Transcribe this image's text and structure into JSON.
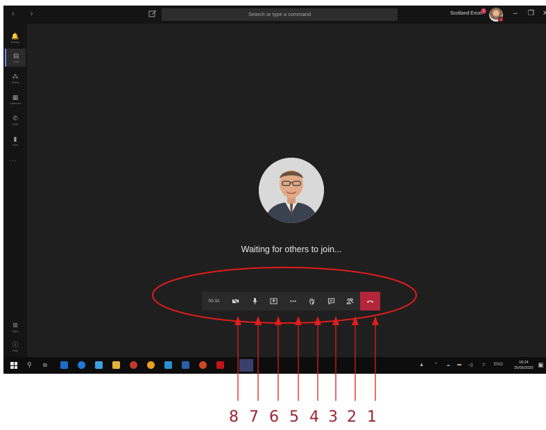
{
  "titlebar": {
    "nav": "‹ ›",
    "search_placeholder": "Search or type a command",
    "org_name": "Scotland Excel",
    "org_badge": "1",
    "minimize": "–",
    "maximize": "❐",
    "close": "✕"
  },
  "rail": {
    "items": [
      {
        "label": "Activity",
        "icon": "bell-icon",
        "glyph": "🔔"
      },
      {
        "label": "Chat",
        "icon": "chat-icon",
        "glyph": "▤"
      },
      {
        "label": "Teams",
        "icon": "teams-icon",
        "glyph": "⁂"
      },
      {
        "label": "Calendar",
        "icon": "calendar-icon",
        "glyph": "▦"
      },
      {
        "label": "Calls",
        "icon": "phone-icon",
        "glyph": "✆"
      },
      {
        "label": "Files",
        "icon": "file-icon",
        "glyph": "▮"
      }
    ],
    "more": "···",
    "apps": "Apps",
    "help": "Help"
  },
  "stage": {
    "waiting_text": "Waiting for others to join..."
  },
  "controls": {
    "timer": "00:31",
    "buttons": [
      {
        "icon": "camera-off-icon"
      },
      {
        "icon": "microphone-icon"
      },
      {
        "icon": "share-screen-icon"
      },
      {
        "icon": "more-options-icon"
      },
      {
        "icon": "raise-hand-icon"
      },
      {
        "icon": "chat-icon"
      },
      {
        "icon": "participants-icon"
      },
      {
        "icon": "hang-up-icon"
      }
    ]
  },
  "taskbar": {
    "tray_language": "ENG",
    "clock_time": "18:24",
    "clock_date": "25/05/2020"
  },
  "annotations": {
    "numbers": [
      "8",
      "7",
      "6",
      "5",
      "4",
      "3",
      "2",
      "1"
    ],
    "color": "#9b2433",
    "ellipse_color": "#e01c1c"
  }
}
